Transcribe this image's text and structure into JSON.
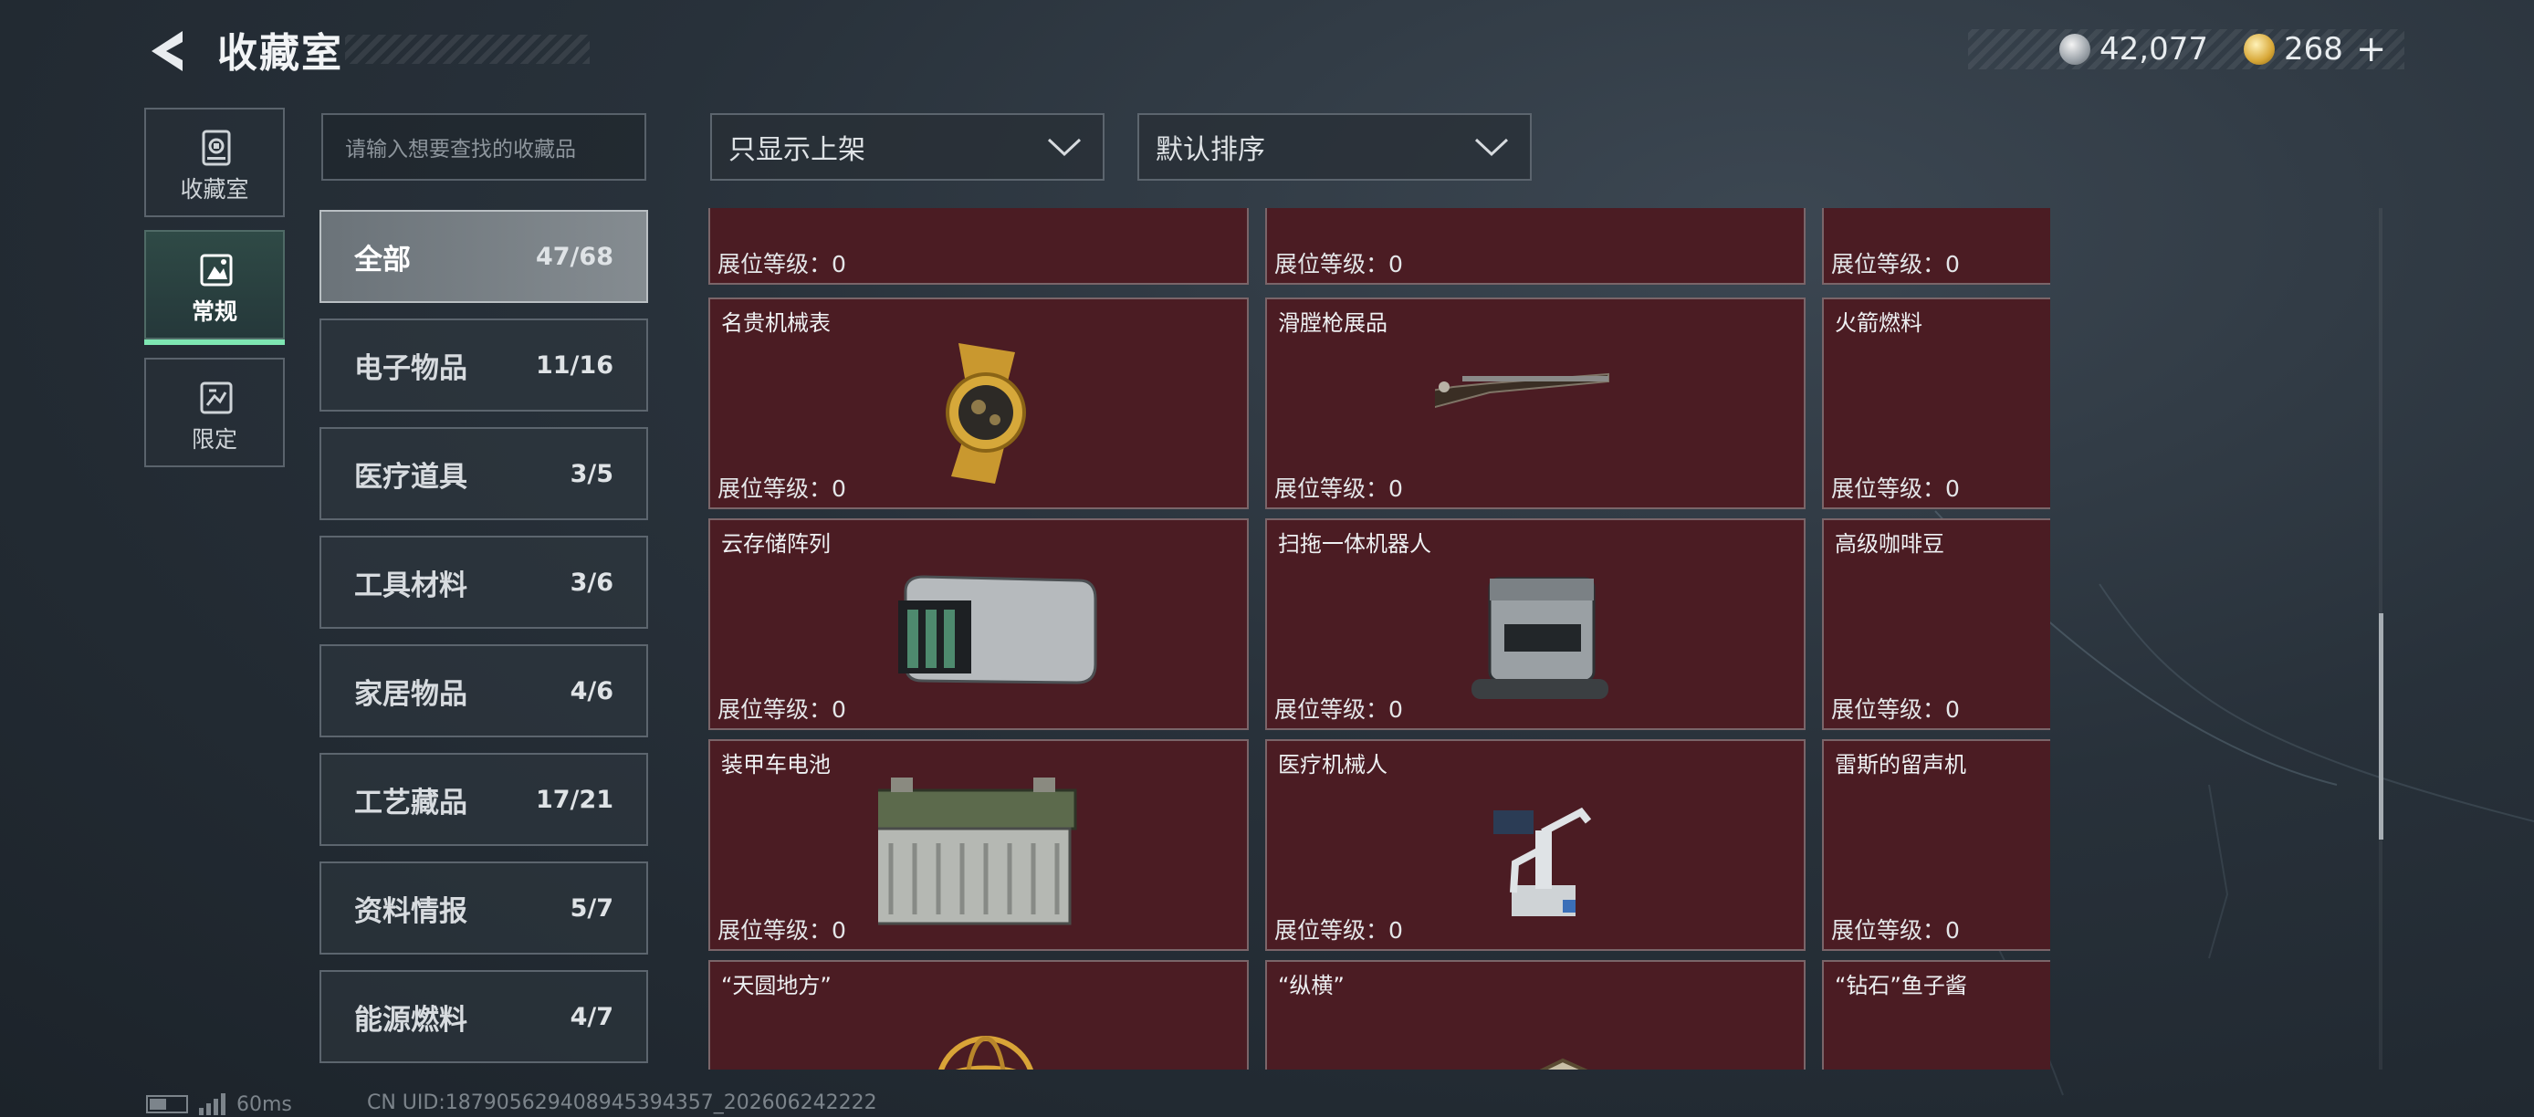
{
  "header": {
    "title": "收藏室",
    "currency_silver": "42,077",
    "currency_gold": "268",
    "add_symbol": "+"
  },
  "nav": [
    {
      "label": "收藏室",
      "icon": "vault-icon"
    },
    {
      "label": "常规",
      "icon": "regular-collection-icon"
    },
    {
      "label": "限定",
      "icon": "limited-collection-icon"
    }
  ],
  "search": {
    "placeholder": "请输入想要查找的收藏品"
  },
  "categories": [
    {
      "label": "全部",
      "count": "47/68"
    },
    {
      "label": "电子物品",
      "count": "11/16"
    },
    {
      "label": "医疗道具",
      "count": "3/5"
    },
    {
      "label": "工具材料",
      "count": "3/6"
    },
    {
      "label": "家居物品",
      "count": "4/6"
    },
    {
      "label": "工艺藏品",
      "count": "17/21"
    },
    {
      "label": "资料情报",
      "count": "5/7"
    },
    {
      "label": "能源燃料",
      "count": "4/7"
    }
  ],
  "filters": {
    "display": "只显示上架",
    "sort": "默认排序"
  },
  "level_label": "展位等级：0",
  "items": [
    {
      "name": "",
      "art": "gold-board"
    },
    {
      "name": "",
      "art": "red-case"
    },
    {
      "name": "",
      "art": "cart-wheels"
    },
    {
      "name": "名贵机械表",
      "art": "watch"
    },
    {
      "name": "滑膛枪展品",
      "art": "musket"
    },
    {
      "name": "火箭燃料",
      "art": "fuel-can"
    },
    {
      "name": "云存储阵列",
      "art": "storage-array"
    },
    {
      "name": "扫拖一体机器人",
      "art": "robot-vacuum"
    },
    {
      "name": "高级咖啡豆",
      "art": "coffee-bag"
    },
    {
      "name": "装甲车电池",
      "art": "battery"
    },
    {
      "name": "医疗机械人",
      "art": "medical-robot"
    },
    {
      "name": "雷斯的留声机",
      "art": "gramophone"
    },
    {
      "name": "“天圆地方”",
      "art": "armillary"
    },
    {
      "name": "“纵横”",
      "art": "chessboard"
    },
    {
      "name": "“钻石”鱼子酱",
      "art": "caviar-tin"
    }
  ],
  "scroll_position": 0.47,
  "status": {
    "ping": "60ms",
    "uid": "CN UID:18790562940894539​4357_202606242222"
  }
}
